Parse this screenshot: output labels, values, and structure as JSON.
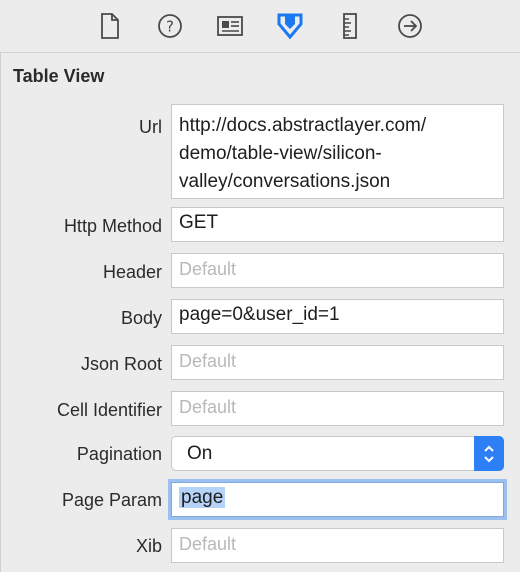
{
  "toolbar": {
    "tabs": [
      {
        "icon": "file-icon",
        "active": false
      },
      {
        "icon": "help-icon",
        "active": false
      },
      {
        "icon": "identity-card-icon",
        "active": false
      },
      {
        "icon": "attributes-icon",
        "active": true
      },
      {
        "icon": "ruler-icon",
        "active": false
      },
      {
        "icon": "connections-arrow-icon",
        "active": false
      }
    ],
    "active_color": "#1a78f2"
  },
  "section": {
    "title": "Table View"
  },
  "fields": {
    "url": {
      "label": "Url",
      "value": "http://docs.abstractlayer.com/demo/table-view/silicon-valley/conversations.json",
      "lines": [
        "http://docs.abstractlayer.com/",
        "demo/table-view/silicon-",
        "valley/conversations.json"
      ]
    },
    "http_method": {
      "label": "Http Method",
      "value": "GET"
    },
    "header": {
      "label": "Header",
      "value": "",
      "placeholder": "Default"
    },
    "body": {
      "label": "Body",
      "value": "page=0&user_id=1"
    },
    "json_root": {
      "label": "Json Root",
      "value": "",
      "placeholder": "Default"
    },
    "cell_identifier": {
      "label": "Cell Identifier",
      "value": "",
      "placeholder": "Default"
    },
    "pagination": {
      "label": "Pagination",
      "selected": "On"
    },
    "page_param": {
      "label": "Page Param",
      "value": "page"
    },
    "xib": {
      "label": "Xib",
      "value": "",
      "placeholder": "Default"
    }
  },
  "colors": {
    "accent": "#2c7ff5",
    "focus_ring": "#9cc0ef",
    "selection": "#b4d3f6"
  }
}
